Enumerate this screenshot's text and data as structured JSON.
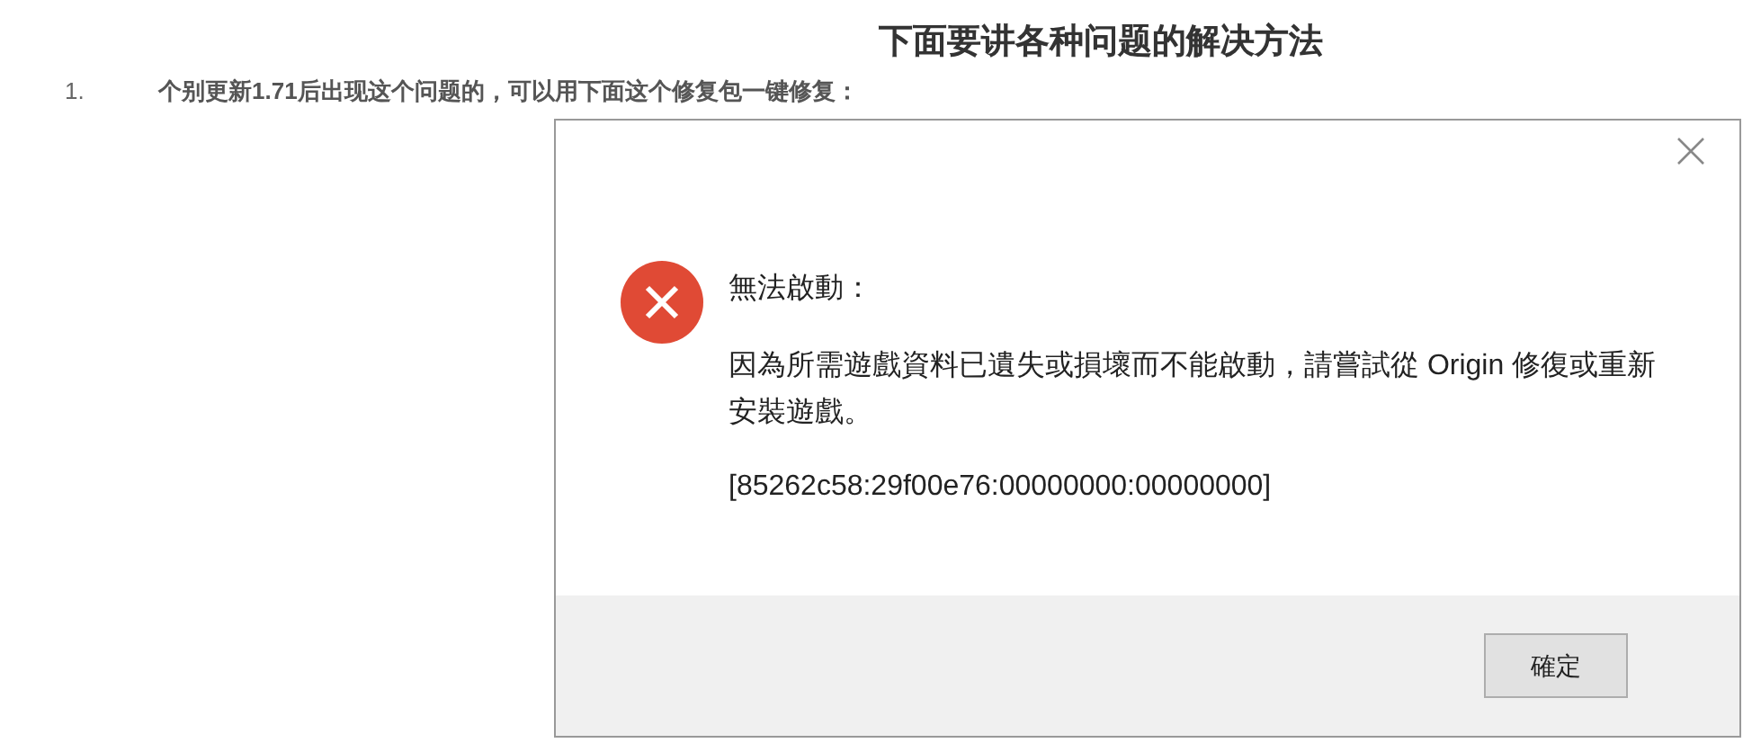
{
  "heading": "下面要讲各种问题的解决方法",
  "list": [
    {
      "number": "1.",
      "text": "个别更新1.71后出现这个问题的，可以用下面这个修复包一键修复："
    }
  ],
  "dialog": {
    "title": "無法啟動：",
    "message": "因為所需遊戲資料已遺失或損壞而不能啟動，請嘗試從 Origin 修復或重新安裝遊戲。",
    "code": "[85262c58:29f00e76:00000000:00000000]",
    "button": "確定"
  }
}
